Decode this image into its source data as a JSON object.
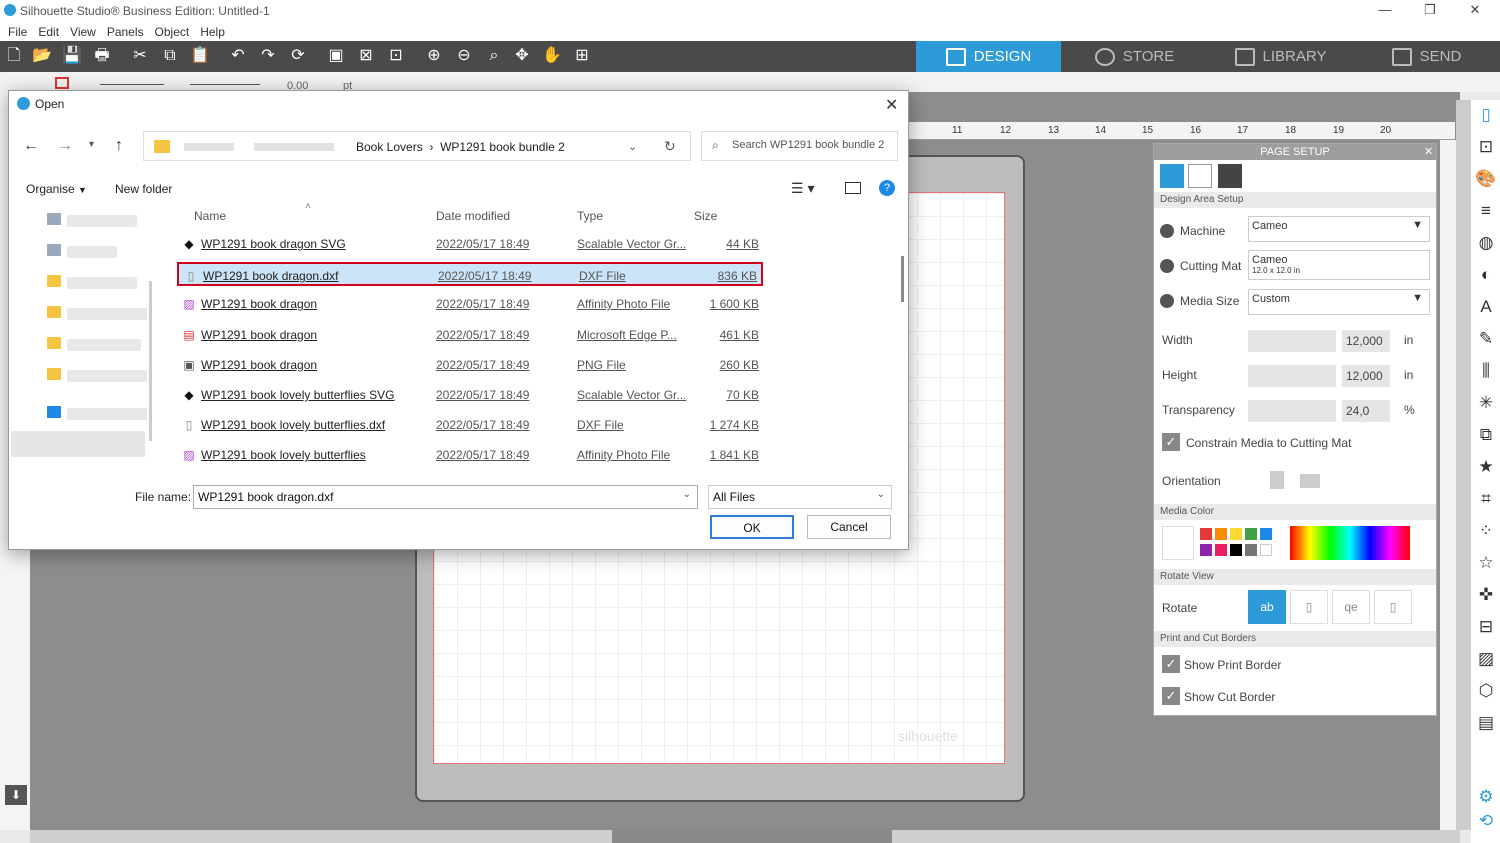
{
  "app": {
    "title": "Silhouette Studio® Business Edition: Untitled-1",
    "window_controls": [
      "—",
      "❐",
      "✕"
    ]
  },
  "menu": [
    "File",
    "Edit",
    "View",
    "Panels",
    "Object",
    "Help"
  ],
  "tabs": [
    {
      "label": "DESIGN",
      "active": true
    },
    {
      "label": "STORE",
      "active": false
    },
    {
      "label": "LIBRARY",
      "active": false
    },
    {
      "label": "SEND",
      "active": false
    }
  ],
  "toolbar2": {
    "line_value": "0.00",
    "line_unit": "pt"
  },
  "ruler": [
    "11",
    "12",
    "13",
    "14",
    "15",
    "16",
    "17",
    "18",
    "19",
    "20"
  ],
  "watermark": "silhouette",
  "panel": {
    "title": "PAGE SETUP",
    "design_area_section": "Design Area Setup",
    "machine_label": "Machine",
    "machine_value": "Cameo",
    "cutting_mat_label": "Cutting Mat",
    "cutting_mat_value": "Cameo",
    "cutting_mat_sub": "12.0 x 12.0 in",
    "media_size_label": "Media Size",
    "media_size_value": "Custom",
    "width_label": "Width",
    "width_value": "12,000",
    "width_unit": "in",
    "height_label": "Height",
    "height_value": "12,000",
    "height_unit": "in",
    "transparency_label": "Transparency",
    "transparency_value": "24,0",
    "transparency_unit": "%",
    "constrain_label": "Constrain Media to Cutting Mat",
    "orientation_label": "Orientation",
    "media_color_section": "Media Color",
    "rotate_view_section": "Rotate View",
    "rotate_label": "Rotate",
    "print_cut_section": "Print and Cut Borders",
    "show_print_border": "Show Print Border",
    "show_cut_border": "Show Cut Border",
    "swatch_colors": [
      "#e53935",
      "#fb8c00",
      "#fdd835",
      "#43a047",
      "#1e88e5",
      "#8e24aa",
      "#e91e63",
      "#000000",
      "#757575",
      "#ffffff"
    ]
  },
  "dialog": {
    "title": "Open",
    "breadcrumb": [
      "Book Lovers",
      "WP1291 book bundle 2"
    ],
    "search_placeholder": "Search WP1291 book bundle 2",
    "organise": "Organise",
    "new_folder": "New folder",
    "columns": [
      "Name",
      "Date modified",
      "Type",
      "Size"
    ],
    "files": [
      {
        "name": "WP1291 book dragon SVG",
        "date": "2022/05/17 18:49",
        "type": "Scalable Vector Gr...",
        "size": "44 KB",
        "icon": "svg-file-icon",
        "selected": false
      },
      {
        "name": "WP1291 book dragon.dxf",
        "date": "2022/05/17 18:49",
        "type": "DXF File",
        "size": "836 KB",
        "icon": "dxf-file-icon",
        "selected": true
      },
      {
        "name": "WP1291 book dragon",
        "date": "2022/05/17 18:49",
        "type": "Affinity Photo File",
        "size": "1 600 KB",
        "icon": "affinity-file-icon",
        "selected": false
      },
      {
        "name": "WP1291 book dragon",
        "date": "2022/05/17 18:49",
        "type": "Microsoft Edge P...",
        "size": "461 KB",
        "icon": "pdf-file-icon",
        "selected": false
      },
      {
        "name": "WP1291 book dragon",
        "date": "2022/05/17 18:49",
        "type": "PNG File",
        "size": "260 KB",
        "icon": "png-file-icon",
        "selected": false
      },
      {
        "name": "WP1291 book lovely butterflies SVG",
        "date": "2022/05/17 18:49",
        "type": "Scalable Vector Gr...",
        "size": "70 KB",
        "icon": "svg-file-icon",
        "selected": false
      },
      {
        "name": "WP1291 book lovely butterflies.dxf",
        "date": "2022/05/17 18:49",
        "type": "DXF File",
        "size": "1 274 KB",
        "icon": "dxf-file-icon",
        "selected": false
      },
      {
        "name": "WP1291 book lovely butterflies",
        "date": "2022/05/17 18:49",
        "type": "Affinity Photo File",
        "size": "1 841 KB",
        "icon": "affinity-file-icon",
        "selected": false
      }
    ],
    "file_name_label": "File name:",
    "file_name_value": "WP1291 book dragon.dxf",
    "file_type_value": "All Files",
    "ok_label": "OK",
    "cancel_label": "Cancel"
  }
}
